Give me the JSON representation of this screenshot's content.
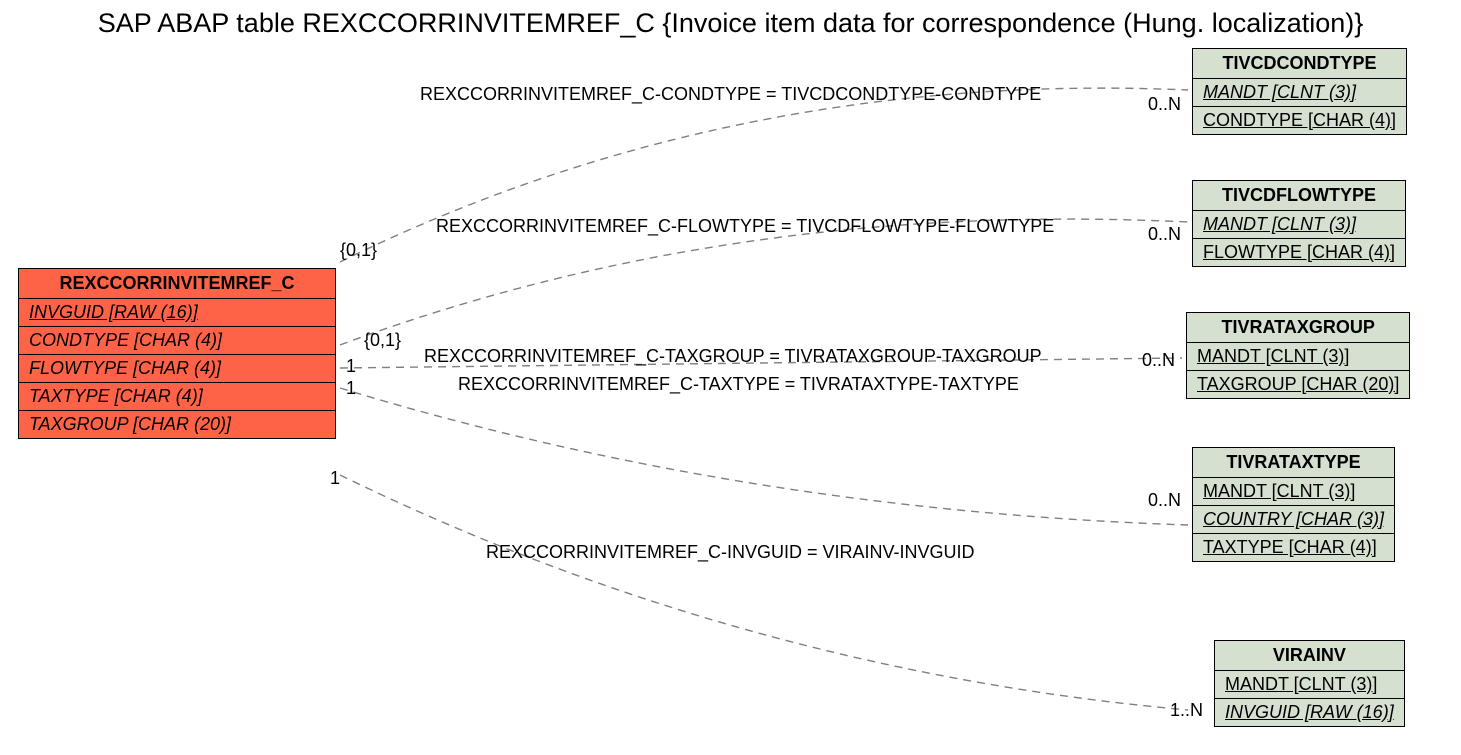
{
  "title": "SAP ABAP table REXCCORRINVITEMREF_C {Invoice item data for correspondence (Hung. localization)}",
  "main": {
    "name": "REXCCORRINVITEMREF_C",
    "fields": {
      "invguid": "INVGUID [RAW (16)]",
      "condtype": "CONDTYPE [CHAR (4)]",
      "flowtype": "FLOWTYPE [CHAR (4)]",
      "taxtype": "TAXTYPE [CHAR (4)]",
      "taxgroup": "TAXGROUP [CHAR (20)]"
    }
  },
  "refs": {
    "tivcdcondtype": {
      "name": "TIVCDCONDTYPE",
      "fields": {
        "mandt": "MANDT [CLNT (3)]",
        "condtype": "CONDTYPE [CHAR (4)]"
      }
    },
    "tivcdflowtype": {
      "name": "TIVCDFLOWTYPE",
      "fields": {
        "mandt": "MANDT [CLNT (3)]",
        "flowtype": "FLOWTYPE [CHAR (4)]"
      }
    },
    "tivrataxgroup": {
      "name": "TIVRATAXGROUP",
      "fields": {
        "mandt": "MANDT [CLNT (3)]",
        "taxgroup": "TAXGROUP [CHAR (20)]"
      }
    },
    "tivrataxtype": {
      "name": "TIVRATAXTYPE",
      "fields": {
        "mandt": "MANDT [CLNT (3)]",
        "country": "COUNTRY [CHAR (3)]",
        "taxtype": "TAXTYPE [CHAR (4)]"
      }
    },
    "virainv": {
      "name": "VIRAINV",
      "fields": {
        "mandt": "MANDT [CLNT (3)]",
        "invguid": "INVGUID [RAW (16)]"
      }
    }
  },
  "relations": {
    "condtype": "REXCCORRINVITEMREF_C-CONDTYPE = TIVCDCONDTYPE-CONDTYPE",
    "flowtype": "REXCCORRINVITEMREF_C-FLOWTYPE = TIVCDFLOWTYPE-FLOWTYPE",
    "taxgroup": "REXCCORRINVITEMREF_C-TAXGROUP = TIVRATAXGROUP-TAXGROUP",
    "taxtype": "REXCCORRINVITEMREF_C-TAXTYPE = TIVRATAXTYPE-TAXTYPE",
    "invguid": "REXCCORRINVITEMREF_C-INVGUID = VIRAINV-INVGUID"
  },
  "card": {
    "left": {
      "c01a": "{0,1}",
      "c01b": "{0,1}",
      "c1a": "1",
      "c1b": "1",
      "c1c": "1"
    },
    "right": {
      "n0a": "0..N",
      "n0b": "0..N",
      "n0c": "0..N",
      "n0d": "0..N",
      "n1": "1..N"
    }
  }
}
